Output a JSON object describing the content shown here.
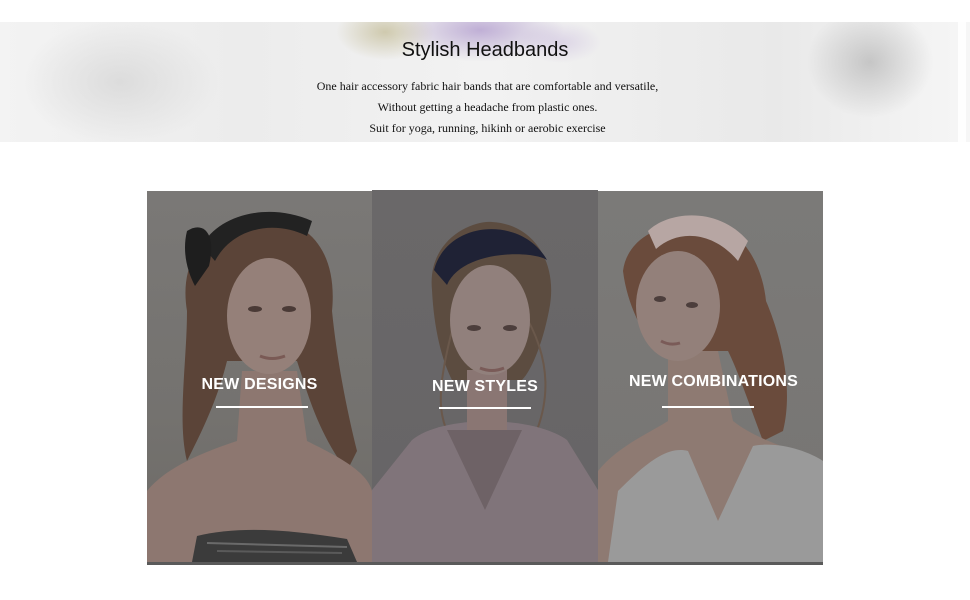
{
  "banner": {
    "title": "Stylish Headbands",
    "lines": [
      "One hair accessory fabric hair bands that are comfortable and versatile,",
      "Without getting a headache from plastic ones.",
      "Suit for yoga, running, hikinh or aerobic exercise"
    ]
  },
  "panels": [
    {
      "label": "NEW DESIGNS"
    },
    {
      "label": "NEW STYLES"
    },
    {
      "label": "NEW COMBINATIONS"
    }
  ],
  "colors": {
    "overlay": "#6f6d6b",
    "caption_text": "#ffffff"
  }
}
